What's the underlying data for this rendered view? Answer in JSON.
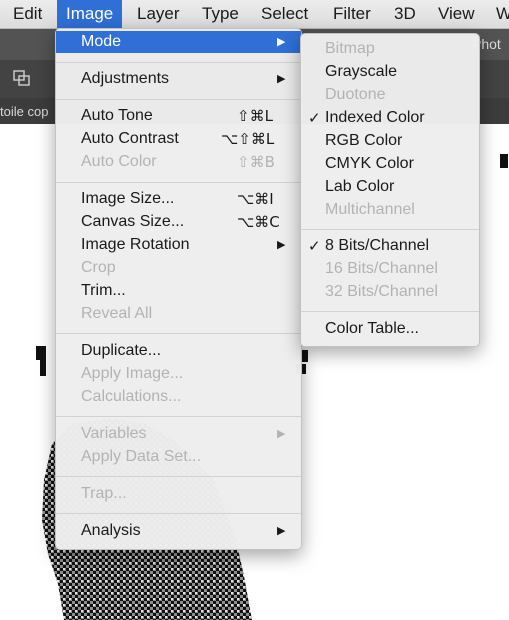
{
  "menubar": {
    "items": [
      "Edit",
      "Image",
      "Layer",
      "Type",
      "Select",
      "Filter",
      "3D",
      "View",
      "W"
    ],
    "active_index": 1
  },
  "app": {
    "tab_title": "Phot",
    "doc_tab": "toile cop"
  },
  "image_menu": {
    "mode": {
      "label": "Mode"
    },
    "adjustments": {
      "label": "Adjustments"
    },
    "auto_tone": {
      "label": "Auto Tone",
      "shortcut": "⇧⌘L"
    },
    "auto_contrast": {
      "label": "Auto Contrast",
      "shortcut": "⌥⇧⌘L"
    },
    "auto_color": {
      "label": "Auto Color",
      "shortcut": "⇧⌘B"
    },
    "image_size": {
      "label": "Image Size...",
      "shortcut": "⌥⌘I"
    },
    "canvas_size": {
      "label": "Canvas Size...",
      "shortcut": "⌥⌘C"
    },
    "image_rotation": {
      "label": "Image Rotation"
    },
    "crop": {
      "label": "Crop"
    },
    "trim": {
      "label": "Trim..."
    },
    "reveal_all": {
      "label": "Reveal All"
    },
    "duplicate": {
      "label": "Duplicate..."
    },
    "apply_image": {
      "label": "Apply Image..."
    },
    "calculations": {
      "label": "Calculations..."
    },
    "variables": {
      "label": "Variables"
    },
    "apply_data_set": {
      "label": "Apply Data Set..."
    },
    "trap": {
      "label": "Trap..."
    },
    "analysis": {
      "label": "Analysis"
    }
  },
  "mode_menu": {
    "bitmap": {
      "label": "Bitmap"
    },
    "grayscale": {
      "label": "Grayscale"
    },
    "duotone": {
      "label": "Duotone"
    },
    "indexed_color": {
      "label": "Indexed Color",
      "checked": true
    },
    "rgb_color": {
      "label": "RGB Color"
    },
    "cmyk_color": {
      "label": "CMYK Color"
    },
    "lab_color": {
      "label": "Lab Color"
    },
    "multichannel": {
      "label": "Multichannel"
    },
    "bits_8": {
      "label": "8 Bits/Channel",
      "checked": true
    },
    "bits_16": {
      "label": "16 Bits/Channel"
    },
    "bits_32": {
      "label": "32 Bits/Channel"
    },
    "color_table": {
      "label": "Color Table..."
    }
  },
  "glyphs": {
    "submenu_arrow": "▶",
    "checkmark": "✓"
  },
  "colors": {
    "highlight": "#2f6fd6",
    "disabled_text": "#b3b3b3"
  }
}
